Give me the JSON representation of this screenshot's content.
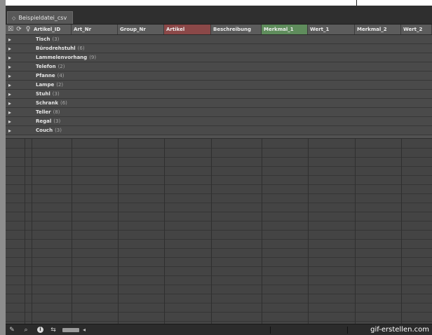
{
  "tab": {
    "label": "Beispieldatei_csv"
  },
  "columns": [
    {
      "label": "Artikel_ID"
    },
    {
      "label": "Art_Nr"
    },
    {
      "label": "Group_Nr"
    },
    {
      "label": "Artikel"
    },
    {
      "label": "Beschreibung"
    },
    {
      "label": "Merkmal_1"
    },
    {
      "label": "Wert_1"
    },
    {
      "label": "Merkmal_2"
    },
    {
      "label": "Wert_2"
    }
  ],
  "groups": [
    {
      "name": "Tisch",
      "count": "(3)"
    },
    {
      "name": "Bürodrehstuhl",
      "count": "(6)"
    },
    {
      "name": "Lammelenvorhang",
      "count": "(9)"
    },
    {
      "name": "Telefon",
      "count": "(2)"
    },
    {
      "name": "Pfanne",
      "count": "(4)"
    },
    {
      "name": "Lampe",
      "count": "(2)"
    },
    {
      "name": "Stuhl",
      "count": "(3)"
    },
    {
      "name": "Schrank",
      "count": "(6)"
    },
    {
      "name": "Teller",
      "count": "(8)"
    },
    {
      "name": "Regal",
      "count": "(3)"
    },
    {
      "name": "Couch",
      "count": "(3)"
    }
  ],
  "watermark": "gif-erstellen.com",
  "colors": {
    "artikel_header": "#8b4848",
    "merkmal_1_header": "#5f8c5c"
  }
}
